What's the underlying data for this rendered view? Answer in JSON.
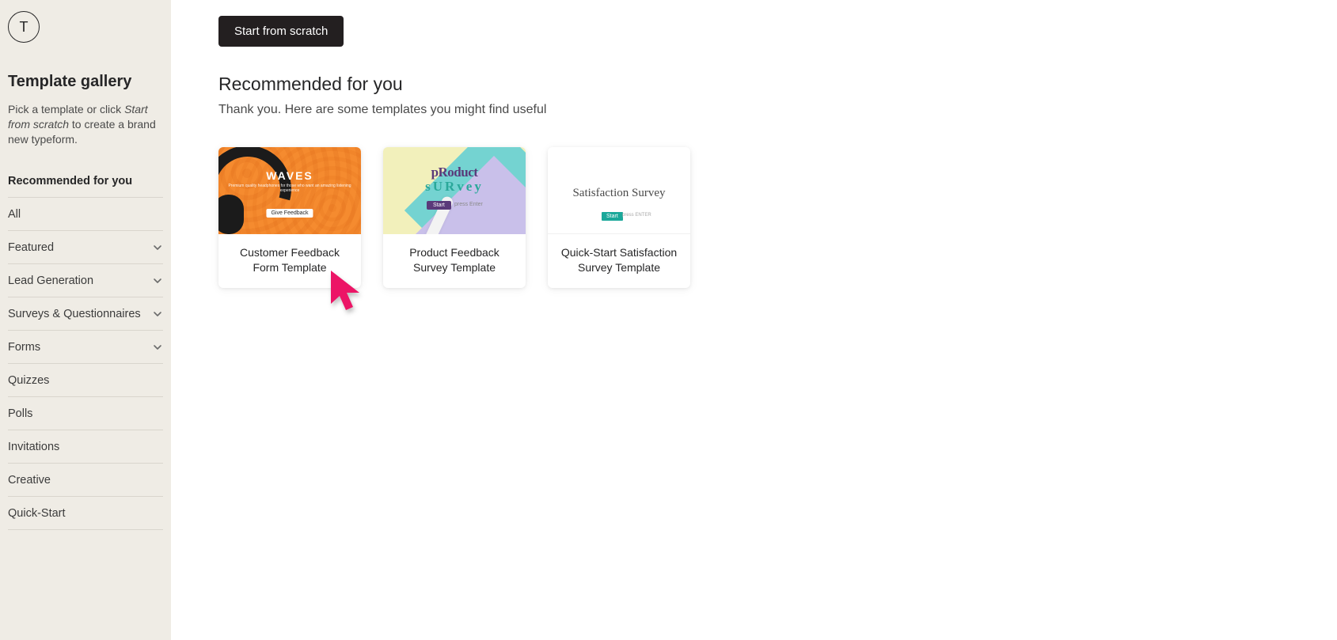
{
  "sidebar": {
    "avatar_letter": "T",
    "title": "Template gallery",
    "desc_pre": "Pick a template or click ",
    "desc_italic": "Start from scratch",
    "desc_post": " to create a brand new typeform.",
    "nav": [
      {
        "label": "Recommended for you",
        "bold": true,
        "expandable": false
      },
      {
        "label": "All",
        "bold": false,
        "expandable": false
      },
      {
        "label": "Featured",
        "bold": false,
        "expandable": true
      },
      {
        "label": "Lead Generation",
        "bold": false,
        "expandable": true
      },
      {
        "label": "Surveys & Questionnaires",
        "bold": false,
        "expandable": true
      },
      {
        "label": "Forms",
        "bold": false,
        "expandable": true
      },
      {
        "label": "Quizzes",
        "bold": false,
        "expandable": false
      },
      {
        "label": "Polls",
        "bold": false,
        "expandable": false
      },
      {
        "label": "Invitations",
        "bold": false,
        "expandable": false
      },
      {
        "label": "Creative",
        "bold": false,
        "expandable": false
      },
      {
        "label": "Quick-Start",
        "bold": false,
        "expandable": false
      }
    ]
  },
  "main": {
    "start_button": "Start from scratch",
    "section_title": "Recommended for you",
    "section_sub": "Thank you. Here are some templates you might find useful",
    "cards": [
      {
        "label": "Customer Feedback Form Template",
        "thumb_brand": "WAVES",
        "thumb_tagline": "Premium quality headphones for those who want an amazing listening experience",
        "thumb_chip": "Give Feedback"
      },
      {
        "label": "Product Feedback Survey Template",
        "thumb_brand_line1": "pRoduct",
        "thumb_brand_line2": "sURvey",
        "thumb_chip": "Start",
        "thumb_chip_hint": "press Enter"
      },
      {
        "label": "Quick-Start Satisfaction Survey Template",
        "thumb_title": "Satisfaction Survey",
        "thumb_chip": "Start",
        "thumb_chip_hint": "press ENTER"
      }
    ]
  }
}
